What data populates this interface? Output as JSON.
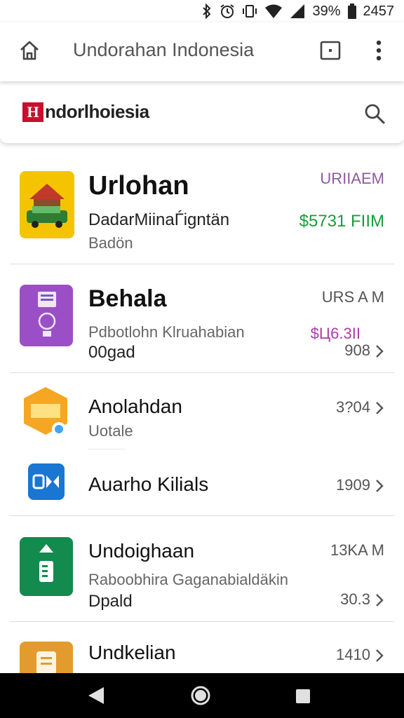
{
  "status_bar": {
    "battery_percent": "39%",
    "time": "2457",
    "icons": [
      "bluetooth-icon",
      "alarm-icon",
      "vibrate-icon",
      "wifi-icon",
      "signal-icon",
      "battery-icon"
    ]
  },
  "browser": {
    "title": "Undorahan Indonesia",
    "icons": [
      "home-icon",
      "tab-icon",
      "more-vert-icon"
    ]
  },
  "site": {
    "logo_mark": "H",
    "logo_text": "ndorlhoiesia",
    "brand_color": "#c8102e",
    "search_icon": "search-icon"
  },
  "items": [
    {
      "name": "Urlohan",
      "subtitle": "DadarMiinaЃigntän",
      "detail": "Badön",
      "meta_top": "URIIAEM",
      "price": "$5731 FIIM",
      "icon_color": "#f5c400",
      "icon": "house-car-icon"
    },
    {
      "name": "Behala",
      "subtitle": "Pdbotlohn Klruahabian",
      "detail": "00gad",
      "meta_top": "URS A M",
      "price": "$Ц6.3II",
      "meta_bottom": "908",
      "icon_color": "#9b4fc7",
      "icon": "device-icon"
    },
    {
      "name": "Anolahdan",
      "detail": "Uotale",
      "meta_top": "3?04",
      "icon_color": "#f5a623",
      "icon": "badge-icon"
    },
    {
      "name": "Auarho Kilials",
      "meta_top": "1909",
      "icon_color": "#1565c0",
      "icon": "video-icon"
    },
    {
      "name": "Undoighaan",
      "subtitle": "Raboobhira Gaganabialdäkin",
      "detail": "Dpald",
      "meta_top": "13KA M",
      "meta_bottom": "30.3",
      "icon_color": "#138a4e",
      "icon": "document-icon"
    },
    {
      "name": "Undkelian",
      "meta_top": "1410",
      "icon_color": "#e39b2e",
      "icon": "app-icon"
    }
  ],
  "nav": {
    "icons": [
      "back-icon",
      "home-circle-icon",
      "recents-icon"
    ]
  }
}
